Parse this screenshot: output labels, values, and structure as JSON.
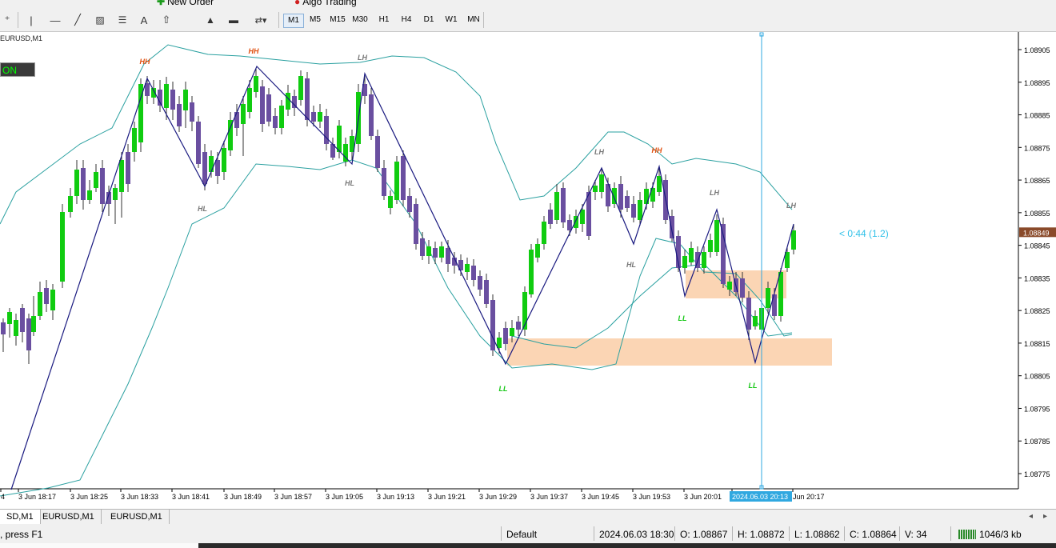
{
  "toolbar_top": {
    "new_order_label": "New Order",
    "algo_trading_label": "Algo Trading"
  },
  "toolbar": {
    "timeframes": [
      "M1",
      "M5",
      "M15",
      "M30",
      "H1",
      "H4",
      "D1",
      "W1",
      "MN"
    ],
    "active_timeframe": "M1"
  },
  "chart": {
    "title": "EURUSD,M1",
    "ea_badge": "ON",
    "countdown": "< 0:44 (1.2)",
    "current_price": "1.08849",
    "price_labels": [
      "1.08905",
      "1.08895",
      "1.08885",
      "1.08875",
      "1.08865",
      "1.08855",
      "1.08845",
      "1.08835",
      "1.08825",
      "1.08815",
      "1.08805",
      "1.08795",
      "1.08785",
      "1.08775"
    ],
    "time_labels": [
      "4",
      "3 Jun 18:17",
      "3 Jun 18:25",
      "3 Jun 18:33",
      "3 Jun 18:41",
      "3 Jun 18:49",
      "3 Jun 18:57",
      "3 Jun 19:05",
      "3 Jun 19:13",
      "3 Jun 19:21",
      "3 Jun 19:29",
      "3 Jun 19:37",
      "3 Jun 19:45",
      "3 Jun 19:53",
      "3 Jun 20:01",
      "2024.06.03 20:13",
      "Jun 20:17"
    ],
    "swing_labels": [
      {
        "text": "HH",
        "type": "HH"
      },
      {
        "text": "HL",
        "type": "HL"
      },
      {
        "text": "HH",
        "type": "HH"
      },
      {
        "text": "LH",
        "type": "LH"
      },
      {
        "text": "HL",
        "type": "HL"
      },
      {
        "text": "LL",
        "type": "LL"
      },
      {
        "text": "LH",
        "type": "LH"
      },
      {
        "text": "HL",
        "type": "HL"
      },
      {
        "text": "HH",
        "type": "HH"
      },
      {
        "text": "LL",
        "type": "LL"
      },
      {
        "text": "LH",
        "type": "LH"
      },
      {
        "text": "LL",
        "type": "LL"
      },
      {
        "text": "LH",
        "type": "LH"
      }
    ],
    "colors": {
      "bull": "#10cc10",
      "bear": "#6a4fa0",
      "zigzag": "#1a1a80",
      "band": "#2aa0a0",
      "zone": "#fbd5b4",
      "hh": "#e05010",
      "lh": "#777777",
      "ll": "#18c818",
      "crosshair": "#30a8e0",
      "price_tag_bg": "#8a4a2a"
    }
  },
  "tabs": [
    "SD,M1",
    "EURUSD,M1",
    "EURUSD,M1"
  ],
  "status": {
    "help": ", press F1",
    "profile": "Default",
    "datetime": "2024.06.03 18:30",
    "open": "O: 1.08867",
    "high": "H: 1.08872",
    "low": "L: 1.08862",
    "close": "C: 1.08864",
    "volume": "V: 34",
    "traffic": "1046/3 kb"
  }
}
